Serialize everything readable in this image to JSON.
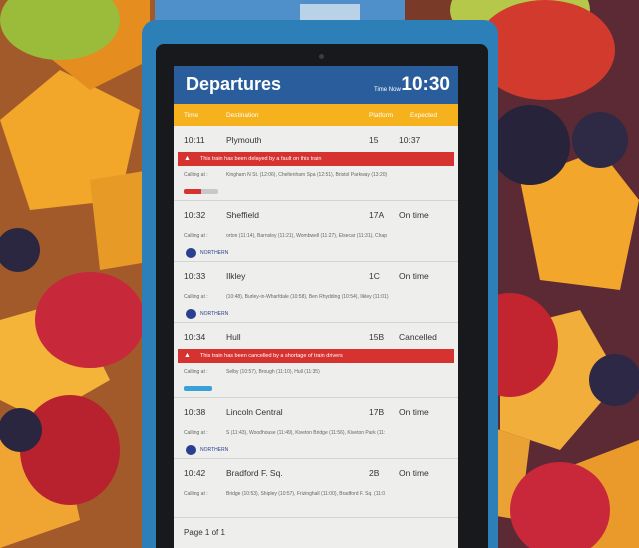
{
  "board": {
    "title": "Departures",
    "time_now_label": "Time Now",
    "time_now_value": "10:30",
    "columns": {
      "time": "Time",
      "destination": "Destination",
      "platform": "Platform",
      "expected": "Expected"
    },
    "calling_label": "Calling at :",
    "page": "Page 1 of 1",
    "colors": {
      "header": "#2a5d9c",
      "columns": "#f5b21c",
      "alert": "#d6322f",
      "kiosk": "#2c7fb7"
    }
  },
  "departures": [
    {
      "time": "10:11",
      "destination": "Plymouth",
      "platform": "15",
      "expected": "10:37",
      "alert": "This train has been delayed by a fault on this train",
      "calling": "Kingham N St. (12:06), Cheltenham Spa (12:51), Bristol Parkway (13:20)",
      "operator_icon": "crosscountry-logo-icon"
    },
    {
      "time": "10:32",
      "destination": "Sheffield",
      "platform": "17A",
      "expected": "On time",
      "alert": "",
      "calling": "orton (11:14), Barnsley (11:21), Wombwell (11:27), Elsecar (11:31), Chap",
      "operator_icon": "northern-logo-icon"
    },
    {
      "time": "10:33",
      "destination": "Ilkley",
      "platform": "1C",
      "expected": "On time",
      "alert": "",
      "calling": "(10:48), Burley-in-Wharfdale (10:58), Ben Rhydding (10:54), Ilkley (11:01)",
      "operator_icon": "northern-logo-icon"
    },
    {
      "time": "10:34",
      "destination": "Hull",
      "platform": "15B",
      "expected": "Cancelled",
      "alert": "This train has been cancelled by a shortage of train drivers",
      "calling": "Selby (10:57), Brough (11:10), Hull (11:35)",
      "operator_icon": "northern-blue-logo-icon"
    },
    {
      "time": "10:38",
      "destination": "Lincoln Central",
      "platform": "17B",
      "expected": "On time",
      "alert": "",
      "calling": "S (11:43), Woodhouse (11:49), Kiveton Bridge (11:56), Kiveton Park (11:",
      "operator_icon": "northern-logo-icon"
    },
    {
      "time": "10:42",
      "destination": "Bradford F. Sq.",
      "platform": "2B",
      "expected": "On time",
      "alert": "",
      "calling": "Bridge (10:53), Shipley (10:57), Frizinghall (11:00), Bradford F. Sq. (11:0",
      "operator_icon": ""
    }
  ],
  "operators": {
    "northern": "NORTHERN"
  }
}
